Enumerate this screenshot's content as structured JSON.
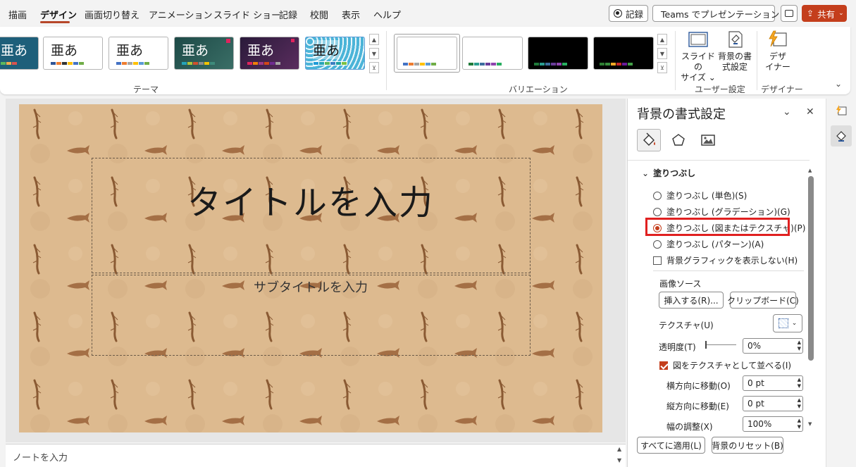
{
  "menu": {
    "items": [
      "描画",
      "デザイン",
      "画面切り替え",
      "アニメーション",
      "スライド ショー",
      "記録",
      "校閲",
      "表示",
      "ヘルプ"
    ],
    "active": "デザイン"
  },
  "top_buttons": {
    "record": "記録",
    "teams": "Teams でプレゼンテーション",
    "share": "共有"
  },
  "ribbon": {
    "themes_label": "テーマ",
    "theme_glyph": "亜あ",
    "variation_label": "バリエーション",
    "user_settings_label": "ユーザー設定",
    "designer_group_label": "デザイナー",
    "slide_size_line1": "スライドの",
    "slide_size_line2": "サイズ ⌄",
    "bg_format_line1": "背景の書",
    "bg_format_line2": "式設定",
    "designer_line1": "デザ",
    "designer_line2": "イナー"
  },
  "slide": {
    "title_placeholder": "タイトルを入力",
    "subtitle_placeholder": "サブタイトルを入力"
  },
  "notes": {
    "placeholder": "ノートを入力"
  },
  "pane": {
    "title": "背景の書式設定",
    "section": "塗りつぶし",
    "fill_options": [
      "塗りつぶし (単色)(S)",
      "塗りつぶし (グラデーション)(G)",
      "塗りつぶし (図またはテクスチャ)(P)",
      "塗りつぶし (パターン)(A)"
    ],
    "selected_fill": "塗りつぶし (図またはテクスチャ)(P)",
    "hide_bg_graphics": "背景グラフィックを表示しない(H)",
    "image_source": "画像ソース",
    "insert_btn": "挿入する(R)...",
    "clipboard_btn": "クリップボード(C)",
    "texture_label": "テクスチャ(U)",
    "transparency_label": "透明度(T)",
    "transparency_value": "0%",
    "tile_checkbox": "図をテクスチャとして並べる(I)",
    "tile_checked": true,
    "offset_x_label": "横方向に移動(O)",
    "offset_x_value": "0 pt",
    "offset_y_label": "縦方向に移動(E)",
    "offset_y_value": "0 pt",
    "scale_x_label": "幅の調整(X)",
    "scale_x_value": "100%",
    "apply_all_btn": "すべてに適用(L)",
    "reset_btn": "背景のリセット(B)"
  },
  "colors": {
    "accent": "#c43e1c",
    "highlight": "#e02020",
    "texture_base": "#ddb98f"
  }
}
